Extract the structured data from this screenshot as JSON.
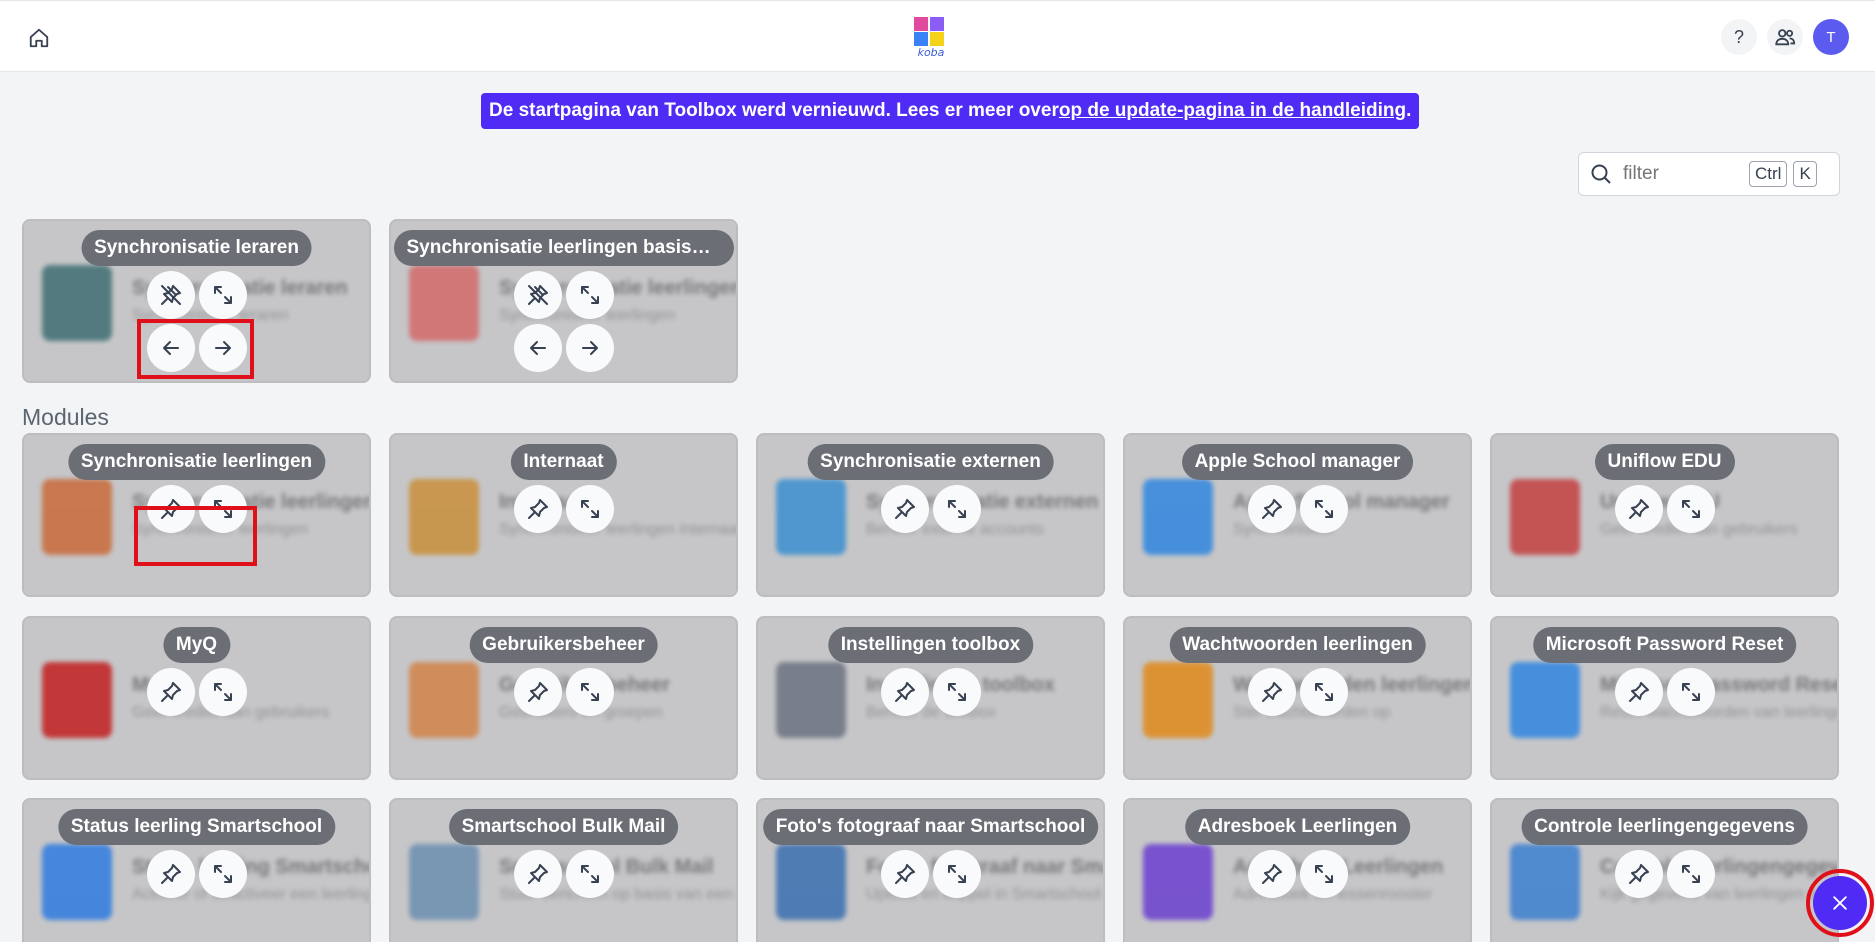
{
  "topbar": {
    "help_label": "?",
    "avatar_initial": "T",
    "logo_text": "koba"
  },
  "banner": {
    "text": "De startpagina van Toolbox werd vernieuwd. Lees er meer over ",
    "link": "op de update-pagina in de handleiding",
    "suffix": "."
  },
  "filter": {
    "placeholder": "filter",
    "kbd1": "Ctrl",
    "kbd2": "K"
  },
  "pinned": [
    {
      "title": "Synchronisatie leraren",
      "bg_title": "Synchronisatie leraren",
      "bg_desc": "Synchroniseer leraren",
      "icon_color": "#3f6f73"
    },
    {
      "title": "Synchronisatie leerlingen basissc...",
      "bg_title": "Synchronisatie leerlingen basisschool",
      "bg_desc": "Synchroniseer leerlingen",
      "icon_color": "#d36a6a"
    }
  ],
  "modules_title": "Modules",
  "modules": [
    {
      "title": "Synchronisatie leerlingen",
      "bg_title": "Synchronisatie leerlingen",
      "bg_desc": "Synchroniseer leerlingen",
      "icon_color": "#c96a3a"
    },
    {
      "title": "Internaat",
      "bg_title": "Internaat",
      "bg_desc": "Synchroniseer leerlingen internaat",
      "icon_color": "#c98f3a"
    },
    {
      "title": "Synchronisatie externen",
      "bg_title": "Synchronisatie externen",
      "bg_desc": "Beheer externe accounts",
      "icon_color": "#3b8fd0"
    },
    {
      "title": "Apple School manager",
      "bg_title": "Apple School manager",
      "bg_desc": "Synchroniseer",
      "icon_color": "#2f86e0"
    },
    {
      "title": "Uniflow EDU",
      "bg_title": "Uniflow EDU",
      "bg_desc": "Geef krediet aan gebruikers",
      "icon_color": "#c44040"
    },
    {
      "title": "MyQ",
      "bg_title": "MyQ",
      "bg_desc": "Geef krediet aan gebruikers",
      "icon_color": "#c21f1f"
    },
    {
      "title": "Gebruikersbeheer",
      "bg_title": "Gebruikersbeheer",
      "bg_desc": "Gebruikers en groepen",
      "icon_color": "#d1844a"
    },
    {
      "title": "Instellingen toolbox",
      "bg_title": "Instellingen toolbox",
      "bg_desc": "Beheer de toolbox",
      "icon_color": "#6b7280"
    },
    {
      "title": "Wachtwoorden leerlingen",
      "bg_title": "Wachtwoorden leerlingen",
      "bg_desc": "Stel wachtwoorden op",
      "icon_color": "#e08a1a"
    },
    {
      "title": "Microsoft Password Reset",
      "bg_title": "Microsoft Password Reset",
      "bg_desc": "Reset wachtwoorden van leerlingen Microsoft AD of Entra",
      "icon_color": "#2f86e0"
    },
    {
      "title": "Status leerling Smartschool",
      "bg_title": "Status leerling Smartschool",
      "bg_desc": "Activeer of deactiveer een leerling in Smartschool",
      "icon_color": "#2f7be0"
    },
    {
      "title": "Smartschool Bulk Mail",
      "bg_title": "Smartschool Bulk Mail",
      "bg_desc": "Stuur berichten op basis van een bestand",
      "icon_color": "#6b8fb0"
    },
    {
      "title": "Foto's fotograaf naar Smartschool",
      "bg_title": "Foto's fotograaf naar Smartschool",
      "bg_desc": "Upload en koppel in Smartschool",
      "icon_color": "#3a6fb0"
    },
    {
      "title": "Adresboek Leerlingen",
      "bg_title": "Adresboek Leerlingen",
      "bg_desc": "Adresboek en lessenrooster",
      "icon_color": "#6b3fd0"
    },
    {
      "title": "Controle leerlingengegevens",
      "bg_title": "Controle leerlingengegevens",
      "bg_desc": "Kijk gegevens van leerlingen na",
      "icon_color": "#3b7fd0"
    }
  ]
}
